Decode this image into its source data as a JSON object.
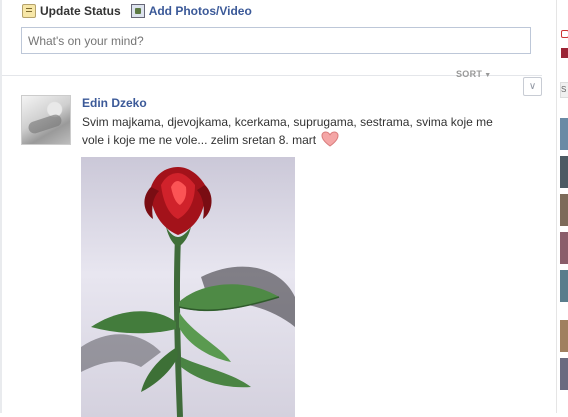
{
  "composer": {
    "tabs": [
      {
        "label": "Update Status",
        "icon": "status-icon"
      },
      {
        "label": "Add Photos/Video",
        "icon": "photo-icon"
      }
    ],
    "placeholder": "What's on your mind?"
  },
  "feed": {
    "sort_label": "SORT"
  },
  "post": {
    "author": "Edin Dzeko",
    "text": "Svim majkama, djevojkama, kcerkama, suprugama, sestrama, svima koje me vole i koje me ne vole... zelim sretan 8. mart",
    "emoticon": "heart-icon"
  },
  "right_column": {
    "label": "S"
  },
  "colors": {
    "link_blue": "#3b5998",
    "input_border": "#bdc7d8",
    "heart_pink": "#f4a6a6"
  }
}
